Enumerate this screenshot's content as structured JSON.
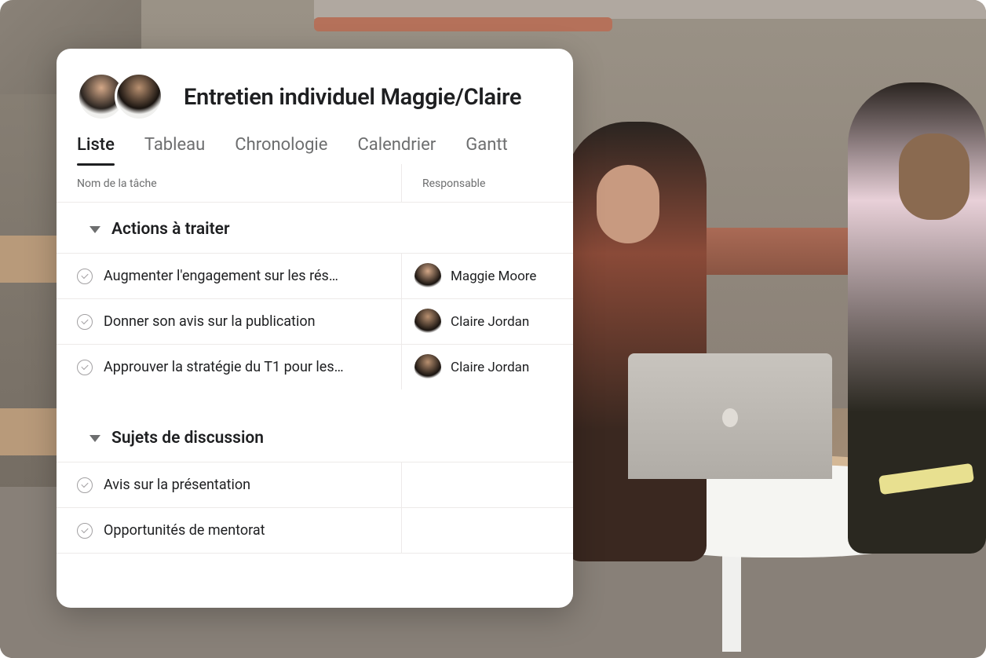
{
  "project": {
    "title": "Entretien individuel Maggie/Claire"
  },
  "tabs": {
    "list": "Liste",
    "board": "Tableau",
    "timeline": "Chronologie",
    "calendar": "Calendrier",
    "gantt": "Gantt"
  },
  "columns": {
    "task_name": "Nom de la tâche",
    "assignee": "Responsable"
  },
  "sections": {
    "actions": {
      "title": "Actions à traiter",
      "tasks": [
        {
          "name": "Augmenter l'engagement sur les rés…",
          "assignee": "Maggie Moore",
          "assignee_key": "maggie"
        },
        {
          "name": "Donner son avis sur la publication",
          "assignee": "Claire Jordan",
          "assignee_key": "claire"
        },
        {
          "name": "Approuver la stratégie du T1 pour les…",
          "assignee": "Claire Jordan",
          "assignee_key": "claire"
        }
      ]
    },
    "discussion": {
      "title": "Sujets de discussion",
      "tasks": [
        {
          "name": "Avis sur la présentation",
          "assignee": "",
          "assignee_key": ""
        },
        {
          "name": "Opportunités de mentorat",
          "assignee": "",
          "assignee_key": ""
        }
      ]
    }
  }
}
